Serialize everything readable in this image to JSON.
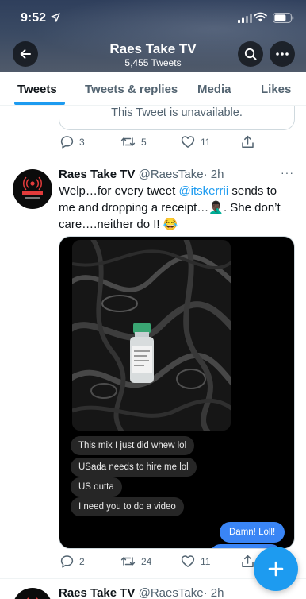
{
  "status_bar": {
    "time": "9:52"
  },
  "header": {
    "title": "Raes Take TV",
    "subtitle": "5,455 Tweets"
  },
  "tabs": [
    {
      "label": "Tweets",
      "active": true
    },
    {
      "label": "Tweets & replies",
      "active": false
    },
    {
      "label": "Media",
      "active": false
    },
    {
      "label": "Likes",
      "active": false
    }
  ],
  "prev_tweet": {
    "unavailable_text": "This Tweet is unavailable.",
    "replies": "3",
    "retweets": "5",
    "likes": "11"
  },
  "tweet": {
    "display_name": "Raes Take TV",
    "handle": "@RaesTake",
    "time": "· 2h",
    "text_before": "Welp…for every tweet ",
    "mention": "@itskerrii",
    "text_after": " sends to me and dropping a receipt…🤦🏿‍♂️. She don’t care….neither do I! 😂",
    "media_messages": [
      "This mix I just did whew lol",
      "USada needs to hire me lol",
      "US outta",
      "I need you to do a video"
    ],
    "media_reply": "Damn! Loll!",
    "replies": "2",
    "retweets": "24",
    "likes": "11"
  },
  "next_tweet": {
    "display_name": "Raes Take TV",
    "handle": "@RaesTake",
    "time": "· 2h"
  },
  "colors": {
    "accent": "#1d9bf0",
    "text_primary": "#0f1419",
    "text_secondary": "#536471",
    "imessage_blue": "#3a85f5"
  },
  "icons": [
    "location-arrow-icon",
    "signal-icon",
    "wifi-icon",
    "battery-icon",
    "back-arrow-icon",
    "search-icon",
    "more-icon",
    "reply-icon",
    "retweet-icon",
    "like-icon",
    "share-icon",
    "compose-plus-icon"
  ]
}
